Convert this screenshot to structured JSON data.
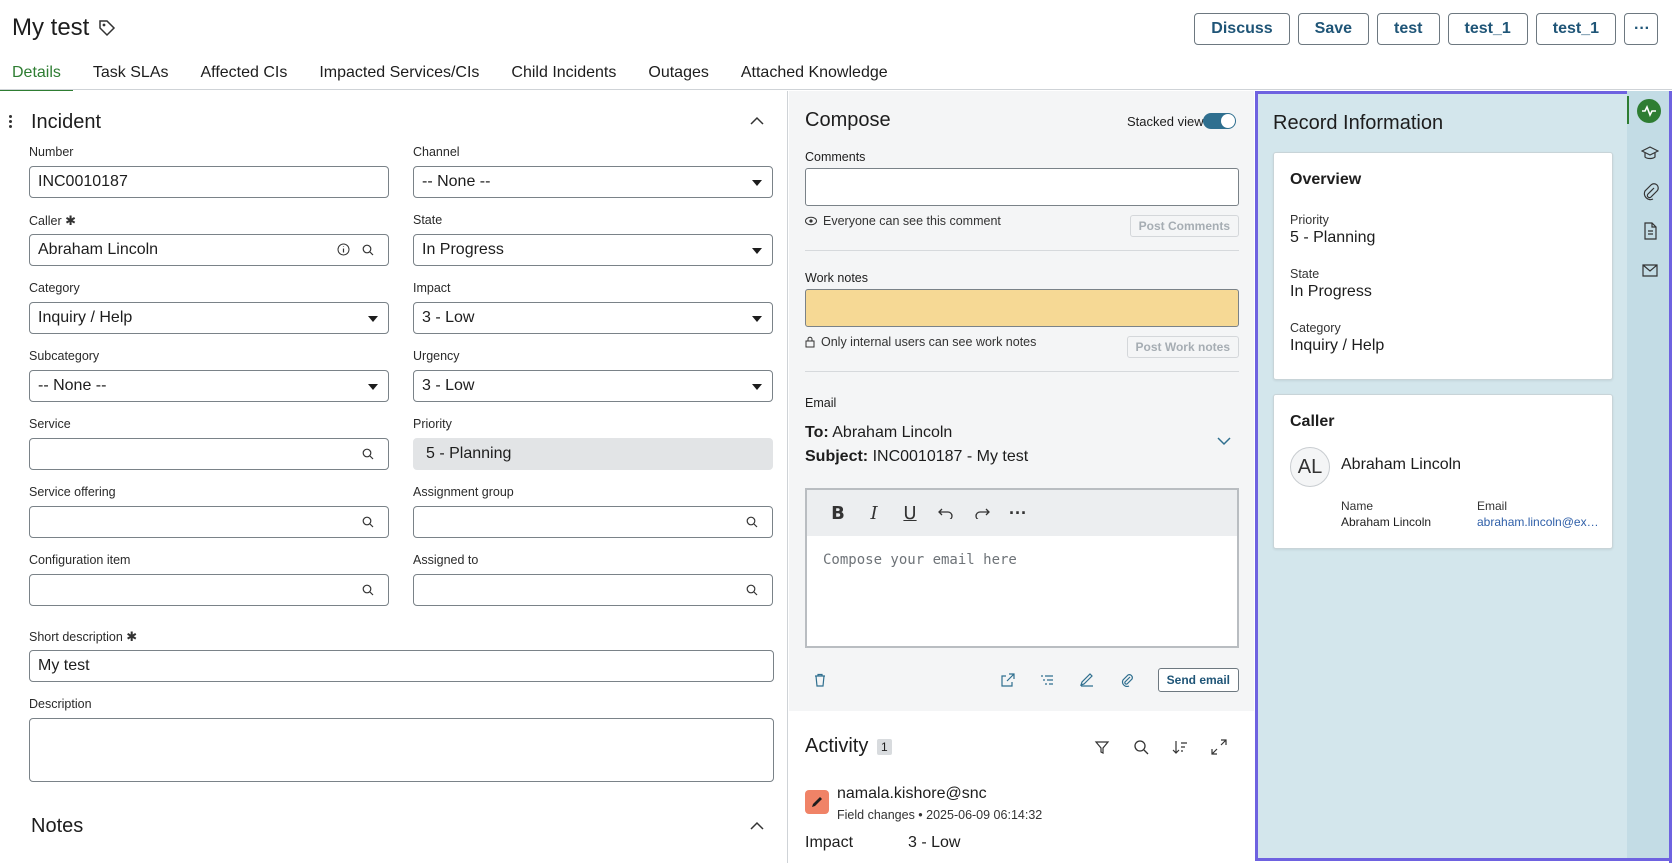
{
  "header": {
    "title": "My test",
    "buttons": [
      "Discuss",
      "Save",
      "test",
      "test_1",
      "test_1"
    ],
    "more_label": "···"
  },
  "tabs": [
    "Details",
    "Task SLAs",
    "Affected CIs",
    "Impacted Services/CIs",
    "Child Incidents",
    "Outages",
    "Attached Knowledge"
  ],
  "form": {
    "section_title": "Incident",
    "notes_title": "Notes",
    "fields": {
      "number": {
        "label": "Number",
        "value": "INC0010187"
      },
      "channel": {
        "label": "Channel",
        "value": "-- None --"
      },
      "caller": {
        "label": "Caller",
        "value": "Abraham Lincoln"
      },
      "state": {
        "label": "State",
        "value": "In Progress"
      },
      "category": {
        "label": "Category",
        "value": "Inquiry / Help"
      },
      "impact": {
        "label": "Impact",
        "value": "3 - Low"
      },
      "subcategory": {
        "label": "Subcategory",
        "value": "-- None --"
      },
      "urgency": {
        "label": "Urgency",
        "value": "3 - Low"
      },
      "service": {
        "label": "Service",
        "value": ""
      },
      "priority": {
        "label": "Priority",
        "value": "5 - Planning"
      },
      "service_offering": {
        "label": "Service offering",
        "value": ""
      },
      "assignment_group": {
        "label": "Assignment group",
        "value": ""
      },
      "configuration_item": {
        "label": "Configuration item",
        "value": ""
      },
      "assigned_to": {
        "label": "Assigned to",
        "value": ""
      },
      "short_description": {
        "label": "Short description",
        "value": "My test"
      },
      "description": {
        "label": "Description",
        "value": ""
      }
    },
    "required_mark": "✱"
  },
  "compose": {
    "title": "Compose",
    "stacked_view_label": "Stacked view",
    "comments_label": "Comments",
    "comments_hint": "Everyone can see this comment",
    "post_comments": "Post Comments",
    "work_notes_label": "Work notes",
    "work_notes_hint": "Only internal users can see work notes",
    "post_work_notes": "Post Work notes",
    "email_label": "Email",
    "to_label": "To:",
    "to_value": "Abraham Lincoln",
    "subject_label": "Subject:",
    "subject_value": "INC0010187 - My test",
    "editor_placeholder": "Compose your email here",
    "send_email": "Send email"
  },
  "activity": {
    "title": "Activity",
    "count": "1",
    "user": "namala.kishore@snc",
    "meta": "Field changes • 2025-06-09 06:14:32",
    "field": "Impact",
    "value": "3 - Low"
  },
  "record_info": {
    "title": "Record Information",
    "overview": {
      "title": "Overview",
      "priority_label": "Priority",
      "priority_value": "5 - Planning",
      "state_label": "State",
      "state_value": "In Progress",
      "category_label": "Category",
      "category_value": "Inquiry / Help"
    },
    "caller": {
      "title": "Caller",
      "initials": "AL",
      "name": "Abraham Lincoln",
      "name_label": "Name",
      "name_value": "Abraham Lincoln",
      "email_label": "Email",
      "email_value": "abraham.lincoln@exa..."
    }
  },
  "colors": {
    "accent_green": "#2e7d32",
    "button_text": "#1f5577",
    "work_notes_bg": "#f6d995",
    "record_bg": "#d3e6ec",
    "highlight_border": "#6e62e0"
  }
}
